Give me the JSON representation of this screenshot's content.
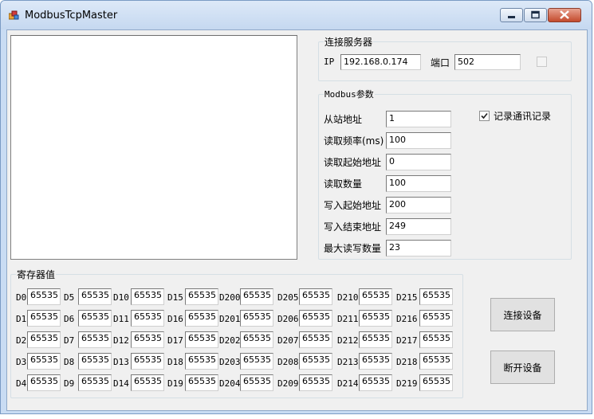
{
  "window": {
    "title": "ModbusTcpMaster"
  },
  "connection": {
    "group_title": "连接服务器",
    "ip_label": "IP",
    "ip_value": "192.168.0.174",
    "port_label": "端口",
    "port_value": "502"
  },
  "modbus": {
    "group_title": "Modbus参数",
    "fields": [
      {
        "label": "从站地址",
        "value": "1"
      },
      {
        "label": "读取频率(ms)",
        "value": "100"
      },
      {
        "label": "读取起始地址",
        "value": "0"
      },
      {
        "label": "读取数量",
        "value": "100"
      },
      {
        "label": "写入起始地址",
        "value": "200"
      },
      {
        "label": "写入结束地址",
        "value": "249"
      },
      {
        "label": "最大读写数量",
        "value": "23"
      }
    ],
    "log_checkbox_label": "记录通讯记录",
    "log_checkbox_checked": true
  },
  "registers": {
    "group_title": "寄存器值",
    "columns": [
      [
        "D0",
        "D1",
        "D2",
        "D3",
        "D4"
      ],
      [
        "D5",
        "D6",
        "D7",
        "D8",
        "D9"
      ],
      [
        "D10",
        "D11",
        "D12",
        "D13",
        "D14"
      ],
      [
        "D15",
        "D16",
        "D17",
        "D18",
        "D19"
      ],
      [
        "D200",
        "D201",
        "D202",
        "D203",
        "D204"
      ],
      [
        "D205",
        "D206",
        "D207",
        "D208",
        "D209"
      ],
      [
        "D210",
        "D211",
        "D212",
        "D213",
        "D214"
      ],
      [
        "D215",
        "D216",
        "D217",
        "D218",
        "D219"
      ]
    ],
    "value": "65535"
  },
  "buttons": {
    "connect": "连接设备",
    "disconnect": "断开设备"
  }
}
